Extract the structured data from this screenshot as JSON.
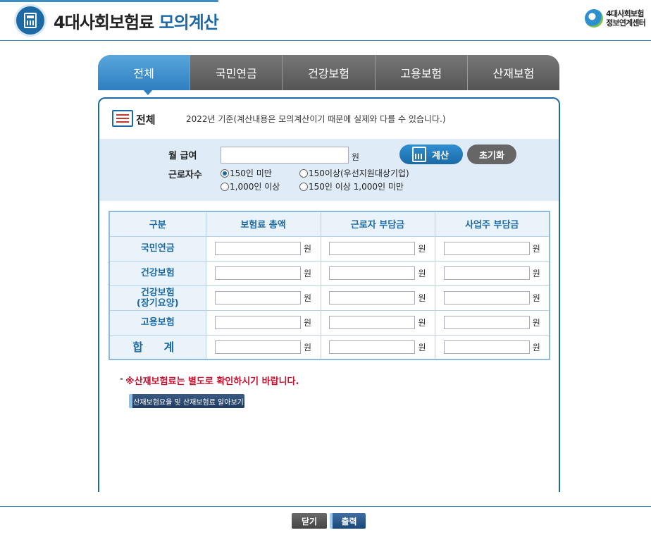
{
  "header": {
    "title_main": "4대사회보험료 ",
    "title_accent": "모의계산",
    "logo_line1": "4대사회보험",
    "logo_line2": "정보연계센터"
  },
  "tabs": [
    {
      "label": "전체",
      "active": true
    },
    {
      "label": "국민연금",
      "active": false
    },
    {
      "label": "건강보험",
      "active": false
    },
    {
      "label": "고용보험",
      "active": false
    },
    {
      "label": "산재보험",
      "active": false
    }
  ],
  "section": {
    "title": "전체",
    "note": "2022년 기준(계산내용은 모의계산이기 때문에 실제와 다를 수 있습니다.)"
  },
  "form": {
    "salary_label": "월 급여",
    "salary_value": "",
    "salary_unit": "원",
    "workers_label": "근로자수",
    "calc_label": "계산",
    "reset_label": "초기화",
    "radios": [
      {
        "label": "150인 미만",
        "checked": true
      },
      {
        "label": "150이상(우선지원대상기업)",
        "checked": false
      },
      {
        "label": "1,000인 이상",
        "checked": false
      },
      {
        "label": "150인 이상 1,000인 미만",
        "checked": false
      }
    ]
  },
  "table": {
    "headers": [
      "구분",
      "보험료 총액",
      "근로자 부담금",
      "사업주 부담금"
    ],
    "unit": "원",
    "rows": [
      {
        "label": "국민연금"
      },
      {
        "label": "건강보험"
      },
      {
        "label_line1": "건강보험",
        "label_line2": "(장기요양)"
      },
      {
        "label": "고용보험"
      },
      {
        "label": "합 계"
      }
    ]
  },
  "notice": "※산재보험료는 별도로 확인하시기 바랍니다.",
  "link_button": "산재보험요율 및 산재보험료 알아보기",
  "footer": {
    "close_label": "닫기",
    "print_label": "출력"
  },
  "colors": {
    "accent": "#1b6aa6",
    "warning": "#c8102e",
    "input_area_bg": "#dfecf7"
  }
}
